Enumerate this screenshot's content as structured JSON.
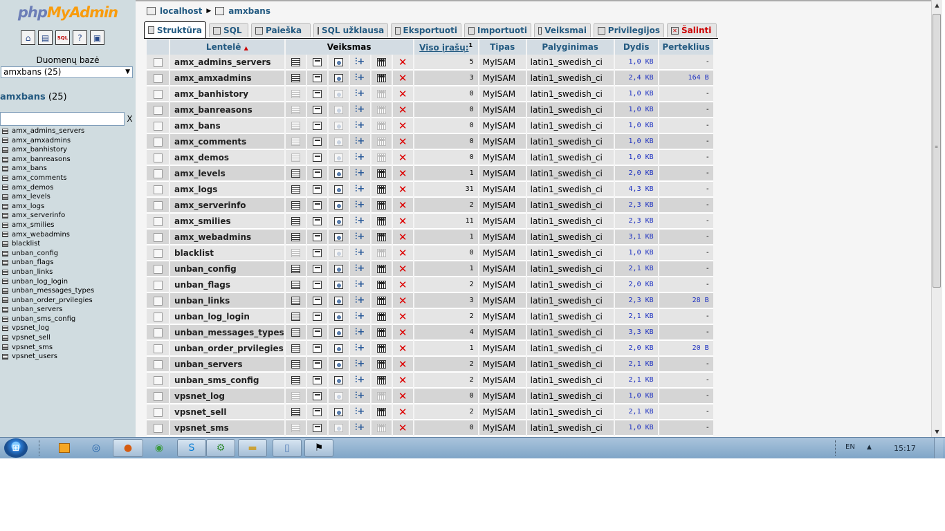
{
  "nav": {
    "logo_php": "php",
    "logo_myadmin": "MyAdmin",
    "icons": [
      "home-icon",
      "query-window-icon",
      "sql-docs-icon",
      "documentation-icon",
      "changelog-icon"
    ],
    "db_label": "Duomenų bazė",
    "db_selected": "amxbans (25)",
    "db_heading_name": "amxbans",
    "db_heading_count": "(25)",
    "filter_clear": "X",
    "tables": [
      "amx_admins_servers",
      "amx_amxadmins",
      "amx_banhistory",
      "amx_banreasons",
      "amx_bans",
      "amx_comments",
      "amx_demos",
      "amx_levels",
      "amx_logs",
      "amx_serverinfo",
      "amx_smilies",
      "amx_webadmins",
      "blacklist",
      "unban_config",
      "unban_flags",
      "unban_links",
      "unban_log_login",
      "unban_messages_types",
      "unban_order_prvilegies",
      "unban_servers",
      "unban_sms_config",
      "vpsnet_log",
      "vpsnet_sell",
      "vpsnet_sms",
      "vpsnet_users"
    ]
  },
  "breadcrumb": {
    "server": "localhost",
    "database": "amxbans"
  },
  "tabs": [
    {
      "label": "Struktūra",
      "active": true
    },
    {
      "label": "SQL"
    },
    {
      "label": "Paieška"
    },
    {
      "label": "SQL užklausa"
    },
    {
      "label": "Eksportuoti"
    },
    {
      "label": "Importuoti"
    },
    {
      "label": "Veiksmai"
    },
    {
      "label": "Privilegijos"
    },
    {
      "label": "Šalinti",
      "danger": true
    }
  ],
  "columns": {
    "table": "Lentelė",
    "sort_indicator": "▲",
    "actions": "Veiksmas",
    "records": "Viso įrašų:",
    "records_sup": "1",
    "type": "Tipas",
    "collation": "Palyginimas",
    "size": "Dydis",
    "overhead": "Perteklius"
  },
  "rows": [
    {
      "name": "amx_admins_servers",
      "records": "5",
      "type": "MyISAM",
      "collation": "latin1_swedish_ci",
      "size": "1,0 KB",
      "overhead": "-",
      "empty": false
    },
    {
      "name": "amx_amxadmins",
      "records": "3",
      "type": "MyISAM",
      "collation": "latin1_swedish_ci",
      "size": "2,4 KB",
      "overhead": "164 B",
      "empty": false
    },
    {
      "name": "amx_banhistory",
      "records": "0",
      "type": "MyISAM",
      "collation": "latin1_swedish_ci",
      "size": "1,0 KB",
      "overhead": "-",
      "empty": true
    },
    {
      "name": "amx_banreasons",
      "records": "0",
      "type": "MyISAM",
      "collation": "latin1_swedish_ci",
      "size": "1,0 KB",
      "overhead": "-",
      "empty": true
    },
    {
      "name": "amx_bans",
      "records": "0",
      "type": "MyISAM",
      "collation": "latin1_swedish_ci",
      "size": "1,0 KB",
      "overhead": "-",
      "empty": true
    },
    {
      "name": "amx_comments",
      "records": "0",
      "type": "MyISAM",
      "collation": "latin1_swedish_ci",
      "size": "1,0 KB",
      "overhead": "-",
      "empty": true
    },
    {
      "name": "amx_demos",
      "records": "0",
      "type": "MyISAM",
      "collation": "latin1_swedish_ci",
      "size": "1,0 KB",
      "overhead": "-",
      "empty": true
    },
    {
      "name": "amx_levels",
      "records": "1",
      "type": "MyISAM",
      "collation": "latin1_swedish_ci",
      "size": "2,0 KB",
      "overhead": "-",
      "empty": false
    },
    {
      "name": "amx_logs",
      "records": "31",
      "type": "MyISAM",
      "collation": "latin1_swedish_ci",
      "size": "4,3 KB",
      "overhead": "-",
      "empty": false
    },
    {
      "name": "amx_serverinfo",
      "records": "2",
      "type": "MyISAM",
      "collation": "latin1_swedish_ci",
      "size": "2,3 KB",
      "overhead": "-",
      "empty": false
    },
    {
      "name": "amx_smilies",
      "records": "11",
      "type": "MyISAM",
      "collation": "latin1_swedish_ci",
      "size": "2,3 KB",
      "overhead": "-",
      "empty": false
    },
    {
      "name": "amx_webadmins",
      "records": "1",
      "type": "MyISAM",
      "collation": "latin1_swedish_ci",
      "size": "3,1 KB",
      "overhead": "-",
      "empty": false
    },
    {
      "name": "blacklist",
      "records": "0",
      "type": "MyISAM",
      "collation": "latin1_swedish_ci",
      "size": "1,0 KB",
      "overhead": "-",
      "empty": true
    },
    {
      "name": "unban_config",
      "records": "1",
      "type": "MyISAM",
      "collation": "latin1_swedish_ci",
      "size": "2,1 KB",
      "overhead": "-",
      "empty": false
    },
    {
      "name": "unban_flags",
      "records": "2",
      "type": "MyISAM",
      "collation": "latin1_swedish_ci",
      "size": "2,0 KB",
      "overhead": "-",
      "empty": false
    },
    {
      "name": "unban_links",
      "records": "3",
      "type": "MyISAM",
      "collation": "latin1_swedish_ci",
      "size": "2,3 KB",
      "overhead": "28 B",
      "empty": false
    },
    {
      "name": "unban_log_login",
      "records": "2",
      "type": "MyISAM",
      "collation": "latin1_swedish_ci",
      "size": "2,1 KB",
      "overhead": "-",
      "empty": false
    },
    {
      "name": "unban_messages_types",
      "records": "4",
      "type": "MyISAM",
      "collation": "latin1_swedish_ci",
      "size": "3,3 KB",
      "overhead": "-",
      "empty": false
    },
    {
      "name": "unban_order_prvilegies",
      "records": "1",
      "type": "MyISAM",
      "collation": "latin1_swedish_ci",
      "size": "2,0 KB",
      "overhead": "20 B",
      "empty": false
    },
    {
      "name": "unban_servers",
      "records": "2",
      "type": "MyISAM",
      "collation": "latin1_swedish_ci",
      "size": "2,1 KB",
      "overhead": "-",
      "empty": false
    },
    {
      "name": "unban_sms_config",
      "records": "2",
      "type": "MyISAM",
      "collation": "latin1_swedish_ci",
      "size": "2,1 KB",
      "overhead": "-",
      "empty": false
    },
    {
      "name": "vpsnet_log",
      "records": "0",
      "type": "MyISAM",
      "collation": "latin1_swedish_ci",
      "size": "1,0 KB",
      "overhead": "-",
      "empty": true
    },
    {
      "name": "vpsnet_sell",
      "records": "2",
      "type": "MyISAM",
      "collation": "latin1_swedish_ci",
      "size": "2,1 KB",
      "overhead": "-",
      "empty": false
    },
    {
      "name": "vpsnet_sms",
      "records": "0",
      "type": "MyISAM",
      "collation": "latin1_swedish_ci",
      "size": "1,0 KB",
      "overhead": "-",
      "empty": true
    }
  ],
  "taskbar": {
    "apps": [
      "media-player-icon",
      "messenger-icon",
      "firefox-icon",
      "chrome-icon",
      "skype-icon",
      "network-app-icon",
      "explorer-icon",
      "notepad-icon",
      "terminal-icon"
    ],
    "lang": "EN",
    "clock": "15:17"
  }
}
